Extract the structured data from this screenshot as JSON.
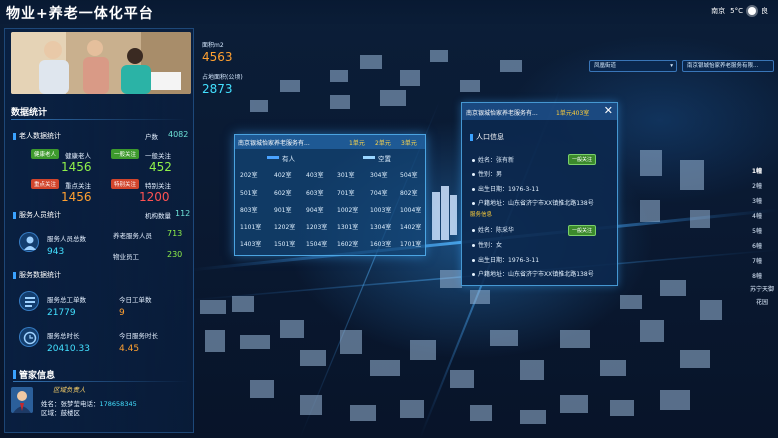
{
  "header": {
    "title": "物业+养老一体化平台",
    "city": "南京",
    "temperature": "5°C",
    "weather": "良"
  },
  "colors": {
    "accent": "#3aa2ff",
    "orange": "#ffa030",
    "green": "#9ce33a",
    "red": "#ff5252",
    "panel": "#0a2343",
    "cyan": "#43e0ff"
  },
  "overlay": {
    "area_label": "面积m2",
    "area_value": "4563",
    "land_label": "占地面积(公顷)",
    "land_value": "2873",
    "dropdown1": "凤凰街道",
    "dropdown2": "南京银城怡家养老服务有限..."
  },
  "stats": {
    "title": "数据统计",
    "elderly": {
      "title": "老人数据统计",
      "households_label": "户数",
      "households": "4082",
      "items": [
        {
          "tag": "健康老人",
          "label": "健康老人",
          "value": "1456"
        },
        {
          "tag": "一般关注",
          "label": "一般关注",
          "value": "452"
        },
        {
          "tag": "重点关注",
          "label": "重点关注",
          "value": "1456"
        },
        {
          "tag": "特别关注",
          "label": "特别关注",
          "value": "1200"
        }
      ]
    },
    "service": {
      "title": "服务人员统计",
      "org_label": "机构数量",
      "org_value": "112",
      "staff_label": "服务人员总数",
      "staff_value": "943",
      "elder_staff_label": "养老服务人员",
      "elder_staff_value": "713",
      "property_label": "物业员工",
      "property_value": "230"
    },
    "orders": {
      "title": "服务数据统计",
      "total_orders_label": "服务总工单数",
      "total_orders_value": "21779",
      "today_orders_label": "今日工单数",
      "today_orders_value": "9",
      "total_hours_label": "服务总时长",
      "total_hours_value": "20410.33",
      "today_hours_label": "今日服务时长",
      "today_hours_value": "4.45"
    },
    "keeper": {
      "title": "管家信息",
      "role": "区域负责人",
      "name_label": "姓名：",
      "name": "张梦莹",
      "phone_label": "电话：",
      "phone": "178658345",
      "area_label": "区域：",
      "area": "鼓楼区"
    }
  },
  "units_panel": {
    "title": "南京银城怡家养老服务有...",
    "tabs": [
      "1单元",
      "2单元",
      "3单元"
    ],
    "occupied_label": "有人",
    "vacant_label": "空置",
    "rows": [
      [
        "202室",
        "402室",
        "403室",
        "301室",
        "304室",
        "504室"
      ],
      [
        "501室",
        "602室",
        "603室",
        "701室",
        "704室",
        "802室"
      ],
      [
        "803室",
        "901室",
        "904室",
        "1002室",
        "1003室",
        "1004室"
      ],
      [
        "1101室",
        "1202室",
        "1203室",
        "1301室",
        "1304室",
        "1402室"
      ],
      [
        "1403室",
        "1501室",
        "1504室",
        "1602室",
        "1603室",
        "1701室"
      ]
    ]
  },
  "info_panel": {
    "title": "南京银城怡家养老服务有...",
    "subtitle": "1单元403室",
    "section": "人口信息",
    "person1": {
      "name_label": "姓名：",
      "name": "张有新",
      "gender_label": "性别：",
      "gender": "男",
      "birth_label": "出生日期：",
      "birth": "1976-3-11",
      "address_label": "户籍地址：",
      "address": "山东省济宁市XX镇推北路138号",
      "status": "一般关注"
    },
    "label2": "服务信息",
    "person2": {
      "name_label": "姓名：",
      "name": "陈采华",
      "gender_label": "性别：",
      "gender": "女",
      "birth_label": "出生日期：",
      "birth": "1976-3-11",
      "address_label": "户籍地址：",
      "address": "山东省济宁市XX镇推北路138号",
      "status": "一般关注"
    }
  },
  "floors": {
    "items": [
      "1幢",
      "2幢",
      "3幢",
      "4幢",
      "5幢",
      "6幢",
      "7幢",
      "8幢"
    ],
    "selected": "1幢",
    "footer1": "苏宁天御",
    "footer2": "花园"
  }
}
